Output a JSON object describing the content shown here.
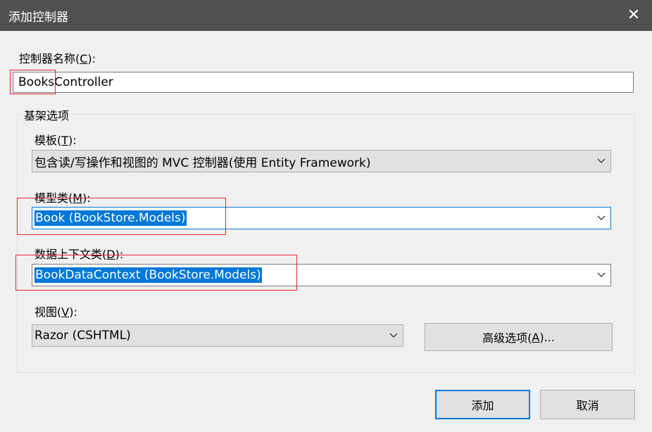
{
  "window": {
    "title": "添加控制器",
    "close_glyph": "✕"
  },
  "controller_name": {
    "label_prefix": "控制器名称(",
    "label_key": "C",
    "label_suffix": "):",
    "value": "BooksController"
  },
  "scaffold": {
    "group_title": "基架选项",
    "template": {
      "label_prefix": "模板(",
      "label_key": "T",
      "label_suffix": "):",
      "value": "包含读/写操作和视图的 MVC 控制器(使用 Entity Framework)"
    },
    "model_class": {
      "label_prefix": "模型类(",
      "label_key": "M",
      "label_suffix": "):",
      "value": "Book (BookStore.Models)"
    },
    "data_context": {
      "label_prefix": "数据上下文类(",
      "label_key": "D",
      "label_suffix": "):",
      "value": "BookDataContext (BookStore.Models)"
    },
    "view": {
      "label_prefix": "视图(",
      "label_key": "V",
      "label_suffix": "):",
      "value": "Razor (CSHTML)"
    },
    "advanced_button": {
      "prefix": "高级选项(",
      "key": "A",
      "suffix": ")..."
    }
  },
  "buttons": {
    "add": "添加",
    "cancel": "取消"
  },
  "colors": {
    "titlebar": "#505050",
    "selection": "#0078d7",
    "annotation": "#e0262e"
  }
}
